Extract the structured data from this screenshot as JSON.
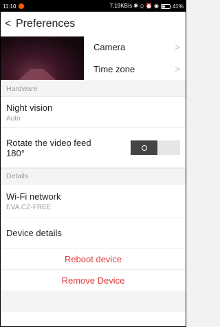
{
  "status_bar": {
    "time": "11:10",
    "right_text": "7,19KB/s ✱ ⎐ ⏰ ◉",
    "battery": "41%"
  },
  "header": {
    "title": "Preferences"
  },
  "camera_section": {
    "camera_label": "Camera",
    "timezone_label": "Time zone"
  },
  "sections": {
    "hardware": "Hardware",
    "details": "Details"
  },
  "hardware": {
    "night_vision_label": "Night vision",
    "night_vision_value": "Auto",
    "rotate_label": "Rotate the video feed 180°"
  },
  "details": {
    "wifi_label": "Wi-Fi network",
    "wifi_value": "EVA.CZ-FREE",
    "device_details_label": "Device details"
  },
  "actions": {
    "reboot": "Reboot device",
    "remove": "Remove Device"
  },
  "colors": {
    "danger": "#e23b3b",
    "toggle_off": "#444444"
  }
}
